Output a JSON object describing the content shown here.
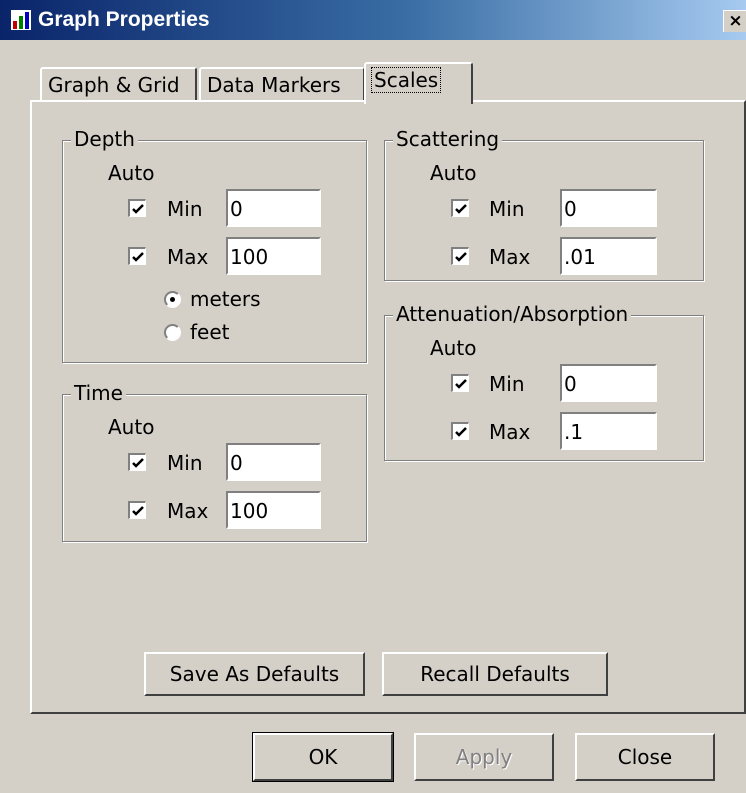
{
  "window": {
    "title": "Graph Properties",
    "close_glyph": "×"
  },
  "tabs": [
    {
      "label": "Graph & Grid",
      "active": false
    },
    {
      "label": "Data Markers",
      "active": false
    },
    {
      "label": "Scales",
      "active": true
    }
  ],
  "depth": {
    "legend": "Depth",
    "auto_label": "Auto",
    "min_label": "Min",
    "min_checked": true,
    "min_value": "0",
    "max_label": "Max",
    "max_checked": true,
    "max_value": "100",
    "units": [
      {
        "label": "meters",
        "selected": true
      },
      {
        "label": "feet",
        "selected": false
      }
    ]
  },
  "time": {
    "legend": "Time",
    "auto_label": "Auto",
    "min_label": "Min",
    "min_checked": true,
    "min_value": "0",
    "max_label": "Max",
    "max_checked": true,
    "max_value": "100"
  },
  "scattering": {
    "legend": "Scattering",
    "auto_label": "Auto",
    "min_label": "Min",
    "min_checked": true,
    "min_value": "0",
    "max_label": "Max",
    "max_checked": true,
    "max_value": ".01"
  },
  "attenuation": {
    "legend": "Attenuation/Absorption",
    "auto_label": "Auto",
    "min_label": "Min",
    "min_checked": true,
    "min_value": "0",
    "max_label": "Max",
    "max_checked": true,
    "max_value": ".1"
  },
  "panel_buttons": {
    "save_defaults": "Save As Defaults",
    "recall_defaults": "Recall Defaults"
  },
  "dialog_buttons": {
    "ok": "OK",
    "apply": "Apply",
    "apply_enabled": false,
    "close": "Close"
  },
  "colors": {
    "face": "#d4d0c8",
    "title_active": "#0a246a",
    "disabled_text": "#808080"
  }
}
